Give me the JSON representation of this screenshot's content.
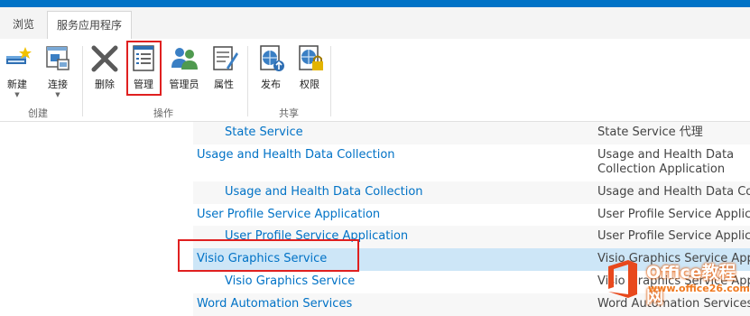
{
  "tabs": [
    {
      "label": "浏览",
      "active": false
    },
    {
      "label": "服务应用程序",
      "active": true
    }
  ],
  "ribbon": {
    "groups": [
      {
        "label": "创建"
      },
      {
        "label": "操作"
      },
      {
        "label": "共享"
      }
    ],
    "buttons": {
      "new": {
        "label": "新建",
        "icon": "new-icon"
      },
      "connect": {
        "label": "连接",
        "icon": "connect-icon"
      },
      "delete": {
        "label": "删除",
        "icon": "delete-icon"
      },
      "manage": {
        "label": "管理",
        "icon": "manage-icon"
      },
      "administrators": {
        "label": "管理员",
        "icon": "administrators-icon"
      },
      "properties": {
        "label": "属性",
        "icon": "properties-icon"
      },
      "publish": {
        "label": "发布",
        "icon": "publish-icon"
      },
      "permissions": {
        "label": "权限",
        "icon": "permissions-icon"
      }
    }
  },
  "services": [
    {
      "name": "State Service",
      "type": "State Service 代理",
      "indent": true
    },
    {
      "name": "Usage and Health Data Collection",
      "type": "Usage and Health Data Collection Application",
      "indent": false
    },
    {
      "name": "Usage and Health Data Collection",
      "type": "Usage and Health Data Collection Proxy",
      "indent": true
    },
    {
      "name": "User Profile Service Application",
      "type": "User Profile Service Application",
      "indent": false
    },
    {
      "name": "User Profile Service Application",
      "type": "User Profile Service Application Proxy",
      "indent": true
    },
    {
      "name": "Visio Graphics Service",
      "type": "Visio Graphics Service Application",
      "indent": false,
      "selected": true
    },
    {
      "name": "Visio Graphics Service",
      "type": "Visio Graphics Service Application Proxy",
      "indent": true
    },
    {
      "name": "Word Automation Services",
      "type": "Word Automation Services",
      "indent": false
    }
  ],
  "watermark": {
    "title": "Office教程网",
    "url": "www.office26.com"
  },
  "colors": {
    "accent": "#0072c6",
    "highlight": "#e02020",
    "selected_row": "#cde6f7"
  }
}
